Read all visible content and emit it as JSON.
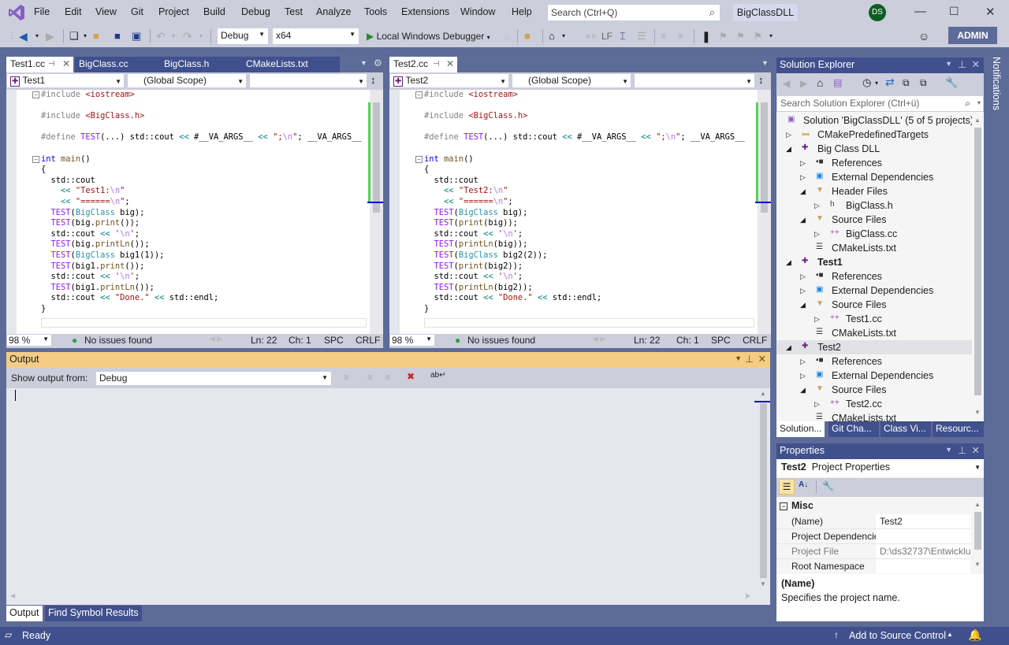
{
  "menu": [
    "File",
    "Edit",
    "View",
    "Git",
    "Project",
    "Build",
    "Debug",
    "Test",
    "Analyze",
    "Tools",
    "Extensions",
    "Window",
    "Help"
  ],
  "search": {
    "placeholder": "Search (Ctrl+Q)"
  },
  "solution_name": "BigClassDLL",
  "user_initials": "DS",
  "toolbar": {
    "config": "Debug",
    "platform": "x64",
    "run_label": "Local Windows Debugger",
    "lf_label": "LF",
    "admin_label": "ADMIN"
  },
  "editor_left": {
    "tabs": [
      {
        "label": "Test1.cc",
        "active": true
      },
      {
        "label": "BigClass.cc"
      },
      {
        "label": "BigClass.h"
      },
      {
        "label": "CMakeLists.txt"
      }
    ],
    "nav_project": "Test1",
    "nav_scope": "(Global Scope)",
    "zoom": "98 %",
    "issues": "No issues found",
    "ln": "Ln: 22",
    "ch": "Ch: 1",
    "spc": "SPC",
    "crlf": "CRLF"
  },
  "editor_right": {
    "tabs": [
      {
        "label": "Test2.cc",
        "active": true
      }
    ],
    "nav_project": "Test2",
    "nav_scope": "(Global Scope)",
    "zoom": "98 %",
    "issues": "No issues found",
    "ln": "Ln: 22",
    "ch": "Ch: 1",
    "spc": "SPC",
    "crlf": "CRLF"
  },
  "output": {
    "title": "Output",
    "show_from_label": "Show output from:",
    "source": "Debug",
    "tabs": [
      "Output",
      "Find Symbol Results"
    ]
  },
  "solution_explorer": {
    "title": "Solution Explorer",
    "search_placeholder": "Search Solution Explorer (Ctrl+ü)",
    "items": [
      {
        "label": "Solution 'BigClassDLL' (5 of 5 projects)",
        "level": 0,
        "icon": "solution-icon",
        "expander": "none"
      },
      {
        "label": "CMakePredefinedTargets",
        "level": 1,
        "icon": "folder-icon",
        "expander": "collapsed"
      },
      {
        "label": "Big Class DLL",
        "level": 1,
        "icon": "project-icon",
        "expander": "expanded"
      },
      {
        "label": "References",
        "level": 2,
        "icon": "references-icon",
        "expander": "collapsed"
      },
      {
        "label": "External Dependencies",
        "level": 2,
        "icon": "external-deps-icon",
        "expander": "collapsed"
      },
      {
        "label": "Header Files",
        "level": 2,
        "icon": "filter-folder-icon",
        "expander": "expanded"
      },
      {
        "label": "BigClass.h",
        "level": 3,
        "icon": "header-file-icon",
        "expander": "collapsed"
      },
      {
        "label": "Source Files",
        "level": 2,
        "icon": "filter-folder-icon",
        "expander": "expanded"
      },
      {
        "label": "BigClass.cc",
        "level": 3,
        "icon": "cpp-file-icon",
        "expander": "collapsed"
      },
      {
        "label": "CMakeLists.txt",
        "level": 2,
        "icon": "text-file-icon",
        "expander": "none"
      },
      {
        "label": "Test1",
        "level": 1,
        "icon": "project-icon",
        "expander": "expanded",
        "bold": true
      },
      {
        "label": "References",
        "level": 2,
        "icon": "references-icon",
        "expander": "collapsed"
      },
      {
        "label": "External Dependencies",
        "level": 2,
        "icon": "external-deps-icon",
        "expander": "collapsed"
      },
      {
        "label": "Source Files",
        "level": 2,
        "icon": "filter-folder-icon",
        "expander": "expanded"
      },
      {
        "label": "Test1.cc",
        "level": 3,
        "icon": "cpp-file-icon",
        "expander": "collapsed"
      },
      {
        "label": "CMakeLists.txt",
        "level": 2,
        "icon": "text-file-icon",
        "expander": "none"
      },
      {
        "label": "Test2",
        "level": 1,
        "icon": "project-icon",
        "expander": "expanded",
        "selected": true
      },
      {
        "label": "References",
        "level": 2,
        "icon": "references-icon",
        "expander": "collapsed"
      },
      {
        "label": "External Dependencies",
        "level": 2,
        "icon": "external-deps-icon",
        "expander": "collapsed"
      },
      {
        "label": "Source Files",
        "level": 2,
        "icon": "filter-folder-icon",
        "expander": "expanded"
      },
      {
        "label": "Test2.cc",
        "level": 3,
        "icon": "cpp-file-icon",
        "expander": "collapsed"
      },
      {
        "label": "CMakeLists.txt",
        "level": 2,
        "icon": "text-file-icon",
        "expander": "none"
      }
    ],
    "bottom_tabs": [
      "Solution...",
      "Git Cha...",
      "Class Vi...",
      "Resourc..."
    ]
  },
  "properties": {
    "title": "Properties",
    "object_name": "Test2",
    "object_type": "Project Properties",
    "category": "Misc",
    "rows": [
      {
        "name": "(Name)",
        "value": "Test2"
      },
      {
        "name": "Project Dependencie",
        "value": ""
      },
      {
        "name": "Project File",
        "value": "D:\\ds32737\\Entwicklu",
        "disabled": true
      },
      {
        "name": "Root Namespace",
        "value": ""
      }
    ],
    "desc_title": "(Name)",
    "desc_text": "Specifies the project name."
  },
  "notifications_label": "Notifications",
  "status": {
    "text": "Ready",
    "source_control": "Add to Source Control"
  },
  "colors": {
    "accent": "#40508d",
    "frame": "#5d6b99",
    "chrome": "#cccedb",
    "output_title": "#f5cc84"
  }
}
